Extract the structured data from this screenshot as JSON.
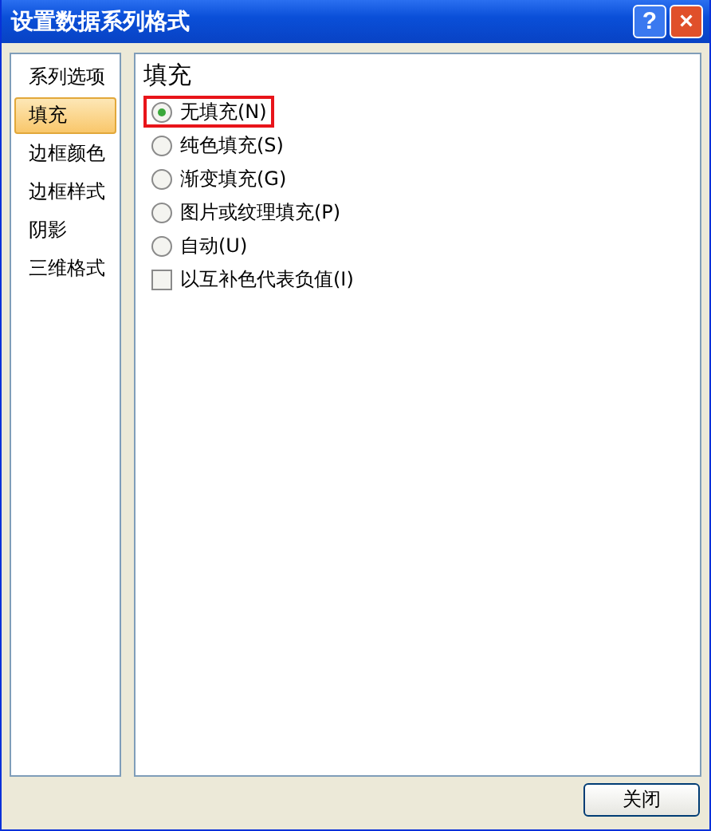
{
  "window": {
    "title": "设置数据系列格式",
    "help": "?",
    "close": "×"
  },
  "sidebar": {
    "items": [
      {
        "label": "系列选项",
        "selected": false
      },
      {
        "label": "填充",
        "selected": true
      },
      {
        "label": "边框颜色",
        "selected": false
      },
      {
        "label": "边框样式",
        "selected": false
      },
      {
        "label": "阴影",
        "selected": false
      },
      {
        "label": "三维格式",
        "selected": false
      }
    ]
  },
  "panel": {
    "heading": "填充",
    "options": [
      {
        "kind": "radio",
        "label": "无填充(N)",
        "selected": true,
        "highlighted": true
      },
      {
        "kind": "radio",
        "label": "纯色填充(S)",
        "selected": false,
        "highlighted": false
      },
      {
        "kind": "radio",
        "label": "渐变填充(G)",
        "selected": false,
        "highlighted": false
      },
      {
        "kind": "radio",
        "label": "图片或纹理填充(P)",
        "selected": false,
        "highlighted": false
      },
      {
        "kind": "radio",
        "label": "自动(U)",
        "selected": false,
        "highlighted": false
      },
      {
        "kind": "checkbox",
        "label": "以互补色代表负值(I)",
        "checked": false,
        "highlighted": false
      }
    ]
  },
  "buttons": [
    "关闭"
  ]
}
